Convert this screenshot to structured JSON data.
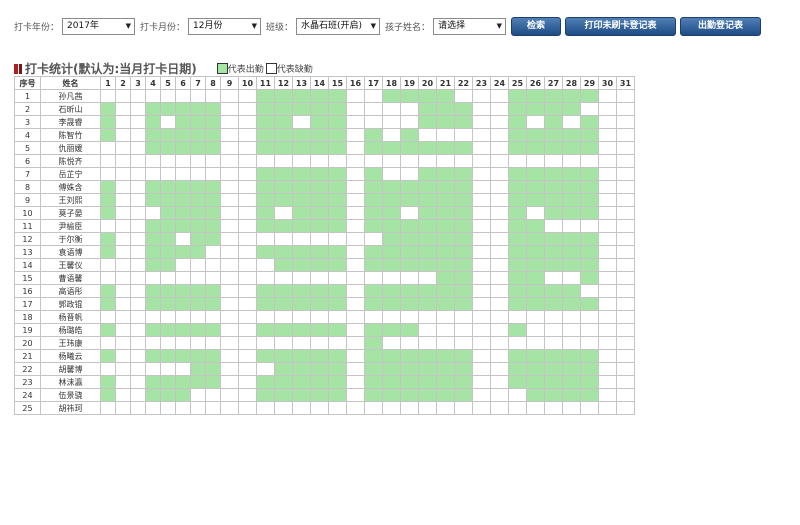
{
  "filters": {
    "year_label": "打卡年份：",
    "year_value": "2017年",
    "month_label": "打卡月份：",
    "month_value": "12月份",
    "class_label": "班级：",
    "class_value": "水晶石班(开启)",
    "child_label": "孩子姓名：",
    "child_value": "请选择"
  },
  "buttons": {
    "search": "检索",
    "print_card": "打印未刷卡登记表",
    "attendance": "出勤登记表"
  },
  "section": {
    "title": "打卡统计(默认为:当月打卡日期)",
    "legend_present": "代表出勤",
    "legend_absent": "代表缺勤"
  },
  "table": {
    "col_index": "序号",
    "col_name": "姓名",
    "days": [
      "1",
      "2",
      "3",
      "4",
      "5",
      "6",
      "7",
      "8",
      "9",
      "10",
      "11",
      "12",
      "13",
      "14",
      "15",
      "16",
      "17",
      "18",
      "19",
      "20",
      "21",
      "22",
      "23",
      "24",
      "25",
      "26",
      "27",
      "28",
      "29",
      "30",
      "31"
    ],
    "rows": [
      {
        "no": "1",
        "name": "孙凡茜",
        "att": "0000000000111110011110001111100"
      },
      {
        "no": "2",
        "name": "石昕山",
        "att": "1001111100111110000111001111000"
      },
      {
        "no": "3",
        "name": "李晟睿",
        "att": "1001011100110110000111001010100"
      },
      {
        "no": "4",
        "name": "陈智竹",
        "att": "1001111100111110101000001111100"
      },
      {
        "no": "5",
        "name": "仇丽媛",
        "att": "0001111100111110111111001111100"
      },
      {
        "no": "6",
        "name": "陈悦齐",
        "att": "0000000000000000000000000000000"
      },
      {
        "no": "7",
        "name": "岳芷宁",
        "att": "0000000000111110100111001111100"
      },
      {
        "no": "8",
        "name": "傅姝含",
        "att": "1001111100111110111111001111100"
      },
      {
        "no": "9",
        "name": "王刘熙",
        "att": "1001111100111110111111001111100"
      },
      {
        "no": "10",
        "name": "莫子晏",
        "att": "1000111100101110110111001011100"
      },
      {
        "no": "11",
        "name": "尹榆臣",
        "att": "0001111100111110111111001100000"
      },
      {
        "no": "12",
        "name": "于尔衡",
        "att": "1001101100000000011111001111100"
      },
      {
        "no": "13",
        "name": "袁语博",
        "att": "1001111000111110111111001111100"
      },
      {
        "no": "14",
        "name": "王馨仪",
        "att": "0001100000011110111111001111100"
      },
      {
        "no": "15",
        "name": "曹语馨",
        "att": "0000000000000000000011001100100"
      },
      {
        "no": "16",
        "name": "高语彤",
        "att": "1001111100111110111111001111000"
      },
      {
        "no": "17",
        "name": "郭政锟",
        "att": "1001111100111110111111001111100"
      },
      {
        "no": "18",
        "name": "杨晋帆",
        "att": "0000000000000000000000000000000"
      },
      {
        "no": "19",
        "name": "杨璐皓",
        "att": "1001111100111110111000001000000"
      },
      {
        "no": "20",
        "name": "王玮康",
        "att": "0000000000000000100000000000000"
      },
      {
        "no": "21",
        "name": "杨曦云",
        "att": "1001111100111110111111001111100"
      },
      {
        "no": "22",
        "name": "胡馨博",
        "att": "0000001100011110111111001111100"
      },
      {
        "no": "23",
        "name": "林沫瀛",
        "att": "1001111100111110111111001111100"
      },
      {
        "no": "24",
        "name": "伍景骁",
        "att": "1001110000111110111111000111100"
      },
      {
        "no": "25",
        "name": "胡祎珂",
        "att": "0000000000000000000000000000000"
      }
    ]
  },
  "colors": {
    "present": "#a6e4a6",
    "grid_border": "#c4c4c4",
    "button": "#1e4d86"
  },
  "icons": {
    "dropdown": "chevron-down-icon",
    "title_marker": "red-bar-icon"
  }
}
